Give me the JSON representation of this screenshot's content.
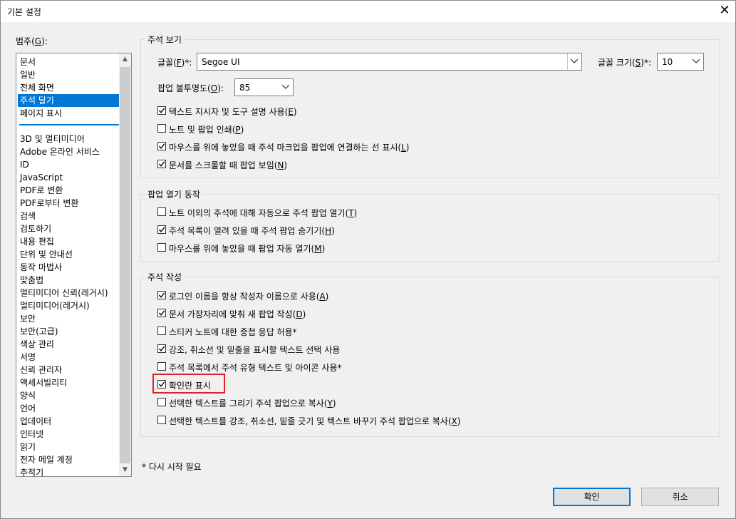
{
  "window": {
    "title": "기본 설정",
    "close_glyph": "✕"
  },
  "categories": {
    "label_pre": "범주(",
    "label_key": "G",
    "label_post": "):",
    "group_a": [
      "문서",
      "일반",
      "전체 화면",
      "주석 달기",
      "페이지 표시"
    ],
    "group_b": [
      "3D 및 멀티미디어",
      "Adobe 온라인 서비스",
      "ID",
      "JavaScript",
      "PDF로 변환",
      "PDF로부터 변환",
      "검색",
      "검토하기",
      "내용 편집",
      "단위 및 안내선",
      "동작 마법사",
      "맞춤법",
      "멀티미디어 신뢰(레거시)",
      "멀티미디어(레거시)",
      "보안",
      "보안(고급)",
      "색상 관리",
      "서명",
      "신뢰 관리자",
      "액세서빌리티",
      "양식",
      "언어",
      "업데이터",
      "인터넷",
      "읽기",
      "전자 메일 계정",
      "추적기"
    ],
    "selected": "주석 달기"
  },
  "view_group": {
    "title": "주석 보기",
    "font_label_pre": "글꼴(",
    "font_key": "F",
    "font_label_post": ")*:",
    "font_value": "Segoe UI",
    "size_label_pre": "글꼴 크기(",
    "size_key": "S",
    "size_label_post": ")*:",
    "size_value": "10",
    "opacity_label_pre": "팝업 불투명도(",
    "opacity_key": "O",
    "opacity_label_post": "):",
    "opacity_value": "85",
    "checks": [
      {
        "pre": "텍스트 지시자 및 도구 설명 사용(",
        "key": "E",
        "post": ")",
        "checked": true
      },
      {
        "pre": "노트 및 팝업 인쇄(",
        "key": "P",
        "post": ")",
        "checked": false
      },
      {
        "pre": "마우스를 위에 놓았을 때 주석 마크업을 팝업에 연결하는 선 표시(",
        "key": "L",
        "post": ")",
        "checked": true
      },
      {
        "pre": "문서를 스크롤할 때 팝업 보임(",
        "key": "N",
        "post": ")",
        "checked": true
      }
    ]
  },
  "popup_group": {
    "title": "팝업 열기 동작",
    "checks": [
      {
        "pre": "노트 이외의 주석에 대해 자동으로 주석 팝업 열기(",
        "key": "T",
        "post": ")",
        "checked": false
      },
      {
        "pre": "주석 목록이 열려 있을 때 주석 팝업 숨기기(",
        "key": "H",
        "post": ")",
        "checked": true
      },
      {
        "pre": "마우스를 위에 놓았을 때 팝업 자동 열기(",
        "key": "M",
        "post": ")",
        "checked": false
      }
    ]
  },
  "create_group": {
    "title": "주석 작성",
    "checks": [
      {
        "pre": "로그인 이름을 항상 작성자 이름으로 사용(",
        "key": "A",
        "post": ")",
        "checked": true
      },
      {
        "pre": "문서 가장자리에 맞춰 새 팝업 작성(",
        "key": "D",
        "post": ")",
        "checked": true
      },
      {
        "pre": "스티커 노트에 대한 중첩 응답 허용*",
        "key": "",
        "post": "",
        "checked": false
      },
      {
        "pre": "강조, 취소선 및 밑줄을 표시할 텍스트 선택 사용",
        "key": "",
        "post": "",
        "checked": true
      },
      {
        "pre": "주석 목록에서 주석 유형 텍스트 및 아이콘 사용*",
        "key": "",
        "post": "",
        "checked": false
      },
      {
        "pre": "확인란 표시",
        "key": "",
        "post": "",
        "checked": true
      },
      {
        "pre": "선택한 텍스트를 그리기 주석 팝업으로 복사(",
        "key": "Y",
        "post": ")",
        "checked": false
      },
      {
        "pre": "선택한 텍스트를 강조, 취소선, 밑줄 긋기 및 텍스트 바꾸기 주석 팝업으로 복사(",
        "key": "X",
        "post": ")",
        "checked": false
      }
    ]
  },
  "note": "* 다시 시작 필요",
  "buttons": {
    "ok": "확인",
    "cancel": "취소"
  },
  "colors": {
    "selection": "#0078d7",
    "highlight_border": "#e0202a",
    "default_button_border": "#0078d7"
  }
}
